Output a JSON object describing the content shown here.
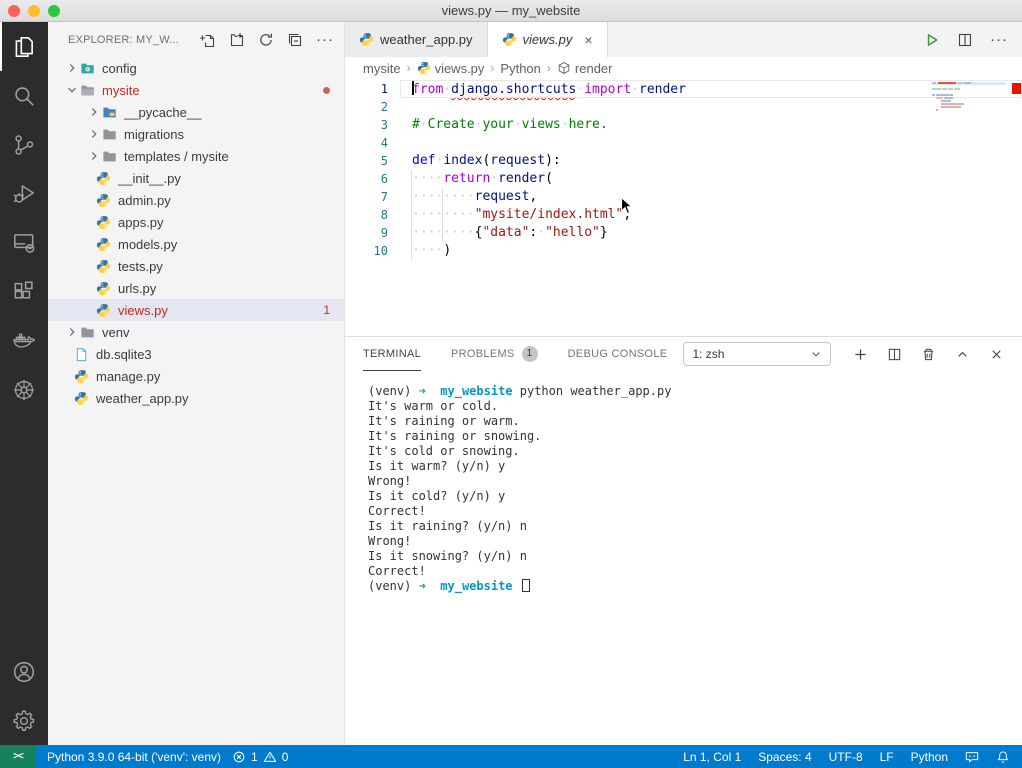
{
  "window": {
    "title": "views.py — my_website"
  },
  "colors": {
    "statusbar": "#007acc",
    "remote": "#16825d",
    "error_red": "#e51400",
    "list_error": "#c22b1e",
    "run_green": "#369432",
    "selection_row": "#e4e6f1"
  },
  "activity_bar": {
    "items": [
      {
        "id": "explorer",
        "active": true
      },
      {
        "id": "search",
        "active": false
      },
      {
        "id": "source-control",
        "active": false
      },
      {
        "id": "run-and-debug",
        "active": false
      },
      {
        "id": "remote-explorer",
        "active": false
      },
      {
        "id": "extensions",
        "active": false
      },
      {
        "id": "docker",
        "active": false
      },
      {
        "id": "kubernetes",
        "active": false
      }
    ],
    "bottom": [
      {
        "id": "accounts"
      },
      {
        "id": "settings"
      }
    ]
  },
  "sidebar": {
    "title": "EXPLORER: MY_W...",
    "actions": [
      {
        "id": "new-file"
      },
      {
        "id": "new-folder"
      },
      {
        "id": "refresh"
      },
      {
        "id": "collapse-all"
      }
    ],
    "more_label": "···",
    "tree": [
      {
        "label": "config",
        "icon": "folder-config",
        "level": 0,
        "chevron": "collapsed"
      },
      {
        "label": "mysite",
        "icon": "folder-open",
        "level": 0,
        "chevron": "expanded",
        "error": true,
        "dot": true
      },
      {
        "label": "__pycache__",
        "icon": "folder-python",
        "level": 1,
        "chevron": "collapsed"
      },
      {
        "label": "migrations",
        "icon": "folder",
        "level": 1,
        "chevron": "collapsed"
      },
      {
        "label": "templates / mysite",
        "icon": "folder",
        "level": 1,
        "chevron": "collapsed"
      },
      {
        "label": "__init__.py",
        "icon": "python",
        "level": 1
      },
      {
        "label": "admin.py",
        "icon": "python",
        "level": 1
      },
      {
        "label": "apps.py",
        "icon": "python",
        "level": 1
      },
      {
        "label": "models.py",
        "icon": "python",
        "level": 1
      },
      {
        "label": "tests.py",
        "icon": "python",
        "level": 1
      },
      {
        "label": "urls.py",
        "icon": "python",
        "level": 1
      },
      {
        "label": "views.py",
        "icon": "python",
        "level": 1,
        "error": true,
        "badge": "1",
        "selected": true
      },
      {
        "label": "venv",
        "icon": "folder",
        "level": 0,
        "chevron": "collapsed"
      },
      {
        "label": "db.sqlite3",
        "icon": "file",
        "level": 0
      },
      {
        "label": "manage.py",
        "icon": "python",
        "level": 0
      },
      {
        "label": "weather_app.py",
        "icon": "python",
        "level": 0
      }
    ]
  },
  "editor": {
    "tabs": [
      {
        "label": "weather_app.py",
        "icon": "python",
        "active": false,
        "italic": false,
        "closable": false
      },
      {
        "label": "views.py",
        "icon": "python",
        "active": true,
        "italic": true,
        "closable": true
      }
    ],
    "close_glyph": "×",
    "actions": [
      {
        "id": "run"
      },
      {
        "id": "split-editor"
      },
      {
        "id": "more-actions",
        "glyph": "···"
      }
    ],
    "breadcrumb": [
      {
        "label": "mysite"
      },
      {
        "label": "views.py",
        "icon": "python"
      },
      {
        "label": "Python"
      },
      {
        "label": "render",
        "icon": "symbol"
      }
    ],
    "breadcrumb_separator": "›",
    "code_lines": [
      {
        "num": "1",
        "current": true,
        "cursor": true,
        "tokens": [
          [
            "kw",
            "from"
          ],
          [
            "ws",
            " "
          ],
          [
            "iderr",
            "django.shortcuts"
          ],
          [
            "ws",
            " "
          ],
          [
            "kw",
            "import"
          ],
          [
            "ws",
            " "
          ],
          [
            "id",
            "render"
          ]
        ]
      },
      {
        "num": "2",
        "tokens": []
      },
      {
        "num": "3",
        "tokens": [
          [
            "cm",
            "#"
          ],
          [
            "ws",
            " "
          ],
          [
            "cm",
            "Create"
          ],
          [
            "ws",
            " "
          ],
          [
            "cm",
            "your"
          ],
          [
            "ws",
            " "
          ],
          [
            "cm",
            "views"
          ],
          [
            "ws",
            " "
          ],
          [
            "cm",
            "here."
          ]
        ]
      },
      {
        "num": "4",
        "tokens": []
      },
      {
        "num": "5",
        "tokens": [
          [
            "kb",
            "def"
          ],
          [
            "ws",
            " "
          ],
          [
            "id",
            "index"
          ],
          [
            "pl",
            "("
          ],
          [
            "id",
            "request"
          ],
          [
            "pl",
            "):"
          ]
        ]
      },
      {
        "num": "6",
        "guides": [
          0
        ],
        "tokens": [
          [
            "ws",
            "    "
          ],
          [
            "kw",
            "return"
          ],
          [
            "ws",
            " "
          ],
          [
            "id",
            "render"
          ],
          [
            "pl",
            "("
          ]
        ]
      },
      {
        "num": "7",
        "guides": [
          0,
          4
        ],
        "tokens": [
          [
            "ws",
            "        "
          ],
          [
            "id",
            "request"
          ],
          [
            "pl",
            ","
          ]
        ]
      },
      {
        "num": "8",
        "guides": [
          0,
          4
        ],
        "tokens": [
          [
            "ws",
            "        "
          ],
          [
            "st",
            "\"mysite/index.html\""
          ],
          [
            "pl",
            ","
          ]
        ]
      },
      {
        "num": "9",
        "guides": [
          0,
          4
        ],
        "tokens": [
          [
            "ws",
            "        "
          ],
          [
            "pl",
            "{"
          ],
          [
            "st",
            "\"data\""
          ],
          [
            "pl",
            ":"
          ],
          [
            "ws",
            " "
          ],
          [
            "st",
            "\"hello\""
          ],
          [
            "pl",
            "}"
          ]
        ]
      },
      {
        "num": "10",
        "guides": [
          0
        ],
        "tokens": [
          [
            "ws",
            "    "
          ],
          [
            "pl",
            ")"
          ]
        ]
      }
    ]
  },
  "panel": {
    "tabs": [
      {
        "label": "TERMINAL",
        "active": true
      },
      {
        "label": "PROBLEMS",
        "badge": "1"
      },
      {
        "label": "DEBUG CONSOLE"
      }
    ],
    "shell_select": {
      "label": "1: zsh"
    },
    "actions": [
      {
        "id": "new-terminal"
      },
      {
        "id": "split-terminal"
      },
      {
        "id": "kill-terminal"
      },
      {
        "id": "maximize-panel"
      },
      {
        "id": "close-panel"
      }
    ],
    "terminal_lines": [
      {
        "tokens": [
          [
            "d",
            "(venv) "
          ],
          [
            "g",
            "➜"
          ],
          [
            "d",
            "  "
          ],
          [
            "c",
            "my_website"
          ],
          [
            "d",
            " python weather_app.py"
          ]
        ]
      },
      {
        "tokens": [
          [
            "d",
            "It's warm or cold."
          ]
        ]
      },
      {
        "tokens": [
          [
            "d",
            "It's raining or warm."
          ]
        ]
      },
      {
        "tokens": [
          [
            "d",
            "It's raining or snowing."
          ]
        ]
      },
      {
        "tokens": [
          [
            "d",
            "It's cold or snowing."
          ]
        ]
      },
      {
        "tokens": [
          [
            "d",
            "Is it warm? (y/n) y"
          ]
        ]
      },
      {
        "tokens": [
          [
            "d",
            "Wrong!"
          ]
        ]
      },
      {
        "tokens": [
          [
            "d",
            "Is it cold? (y/n) y"
          ]
        ]
      },
      {
        "tokens": [
          [
            "d",
            "Correct!"
          ]
        ]
      },
      {
        "tokens": [
          [
            "d",
            "Is it raining? (y/n) n"
          ]
        ]
      },
      {
        "tokens": [
          [
            "d",
            "Wrong!"
          ]
        ]
      },
      {
        "tokens": [
          [
            "d",
            "Is it snowing? (y/n) n"
          ]
        ]
      },
      {
        "tokens": [
          [
            "d",
            "Correct!"
          ]
        ]
      },
      {
        "tokens": [
          [
            "d",
            "(venv) "
          ],
          [
            "g",
            "➜"
          ],
          [
            "d",
            "  "
          ],
          [
            "c",
            "my_website"
          ],
          [
            "d",
            " "
          ]
        ],
        "cursor": true
      }
    ]
  },
  "status_bar": {
    "remote_glyph": "><",
    "left": [
      {
        "id": "python-interpreter",
        "label": "Python 3.9.0 64-bit ('venv': venv)"
      },
      {
        "id": "problems",
        "error_count": "1",
        "warning_count": "0"
      }
    ],
    "right": [
      {
        "id": "cursor-position",
        "label": "Ln 1, Col 1"
      },
      {
        "id": "indentation",
        "label": "Spaces: 4"
      },
      {
        "id": "encoding",
        "label": "UTF-8"
      },
      {
        "id": "eol",
        "label": "LF"
      },
      {
        "id": "language-mode",
        "label": "Python"
      },
      {
        "id": "feedback",
        "icon": "feedback"
      },
      {
        "id": "notifications",
        "icon": "bell"
      }
    ]
  }
}
